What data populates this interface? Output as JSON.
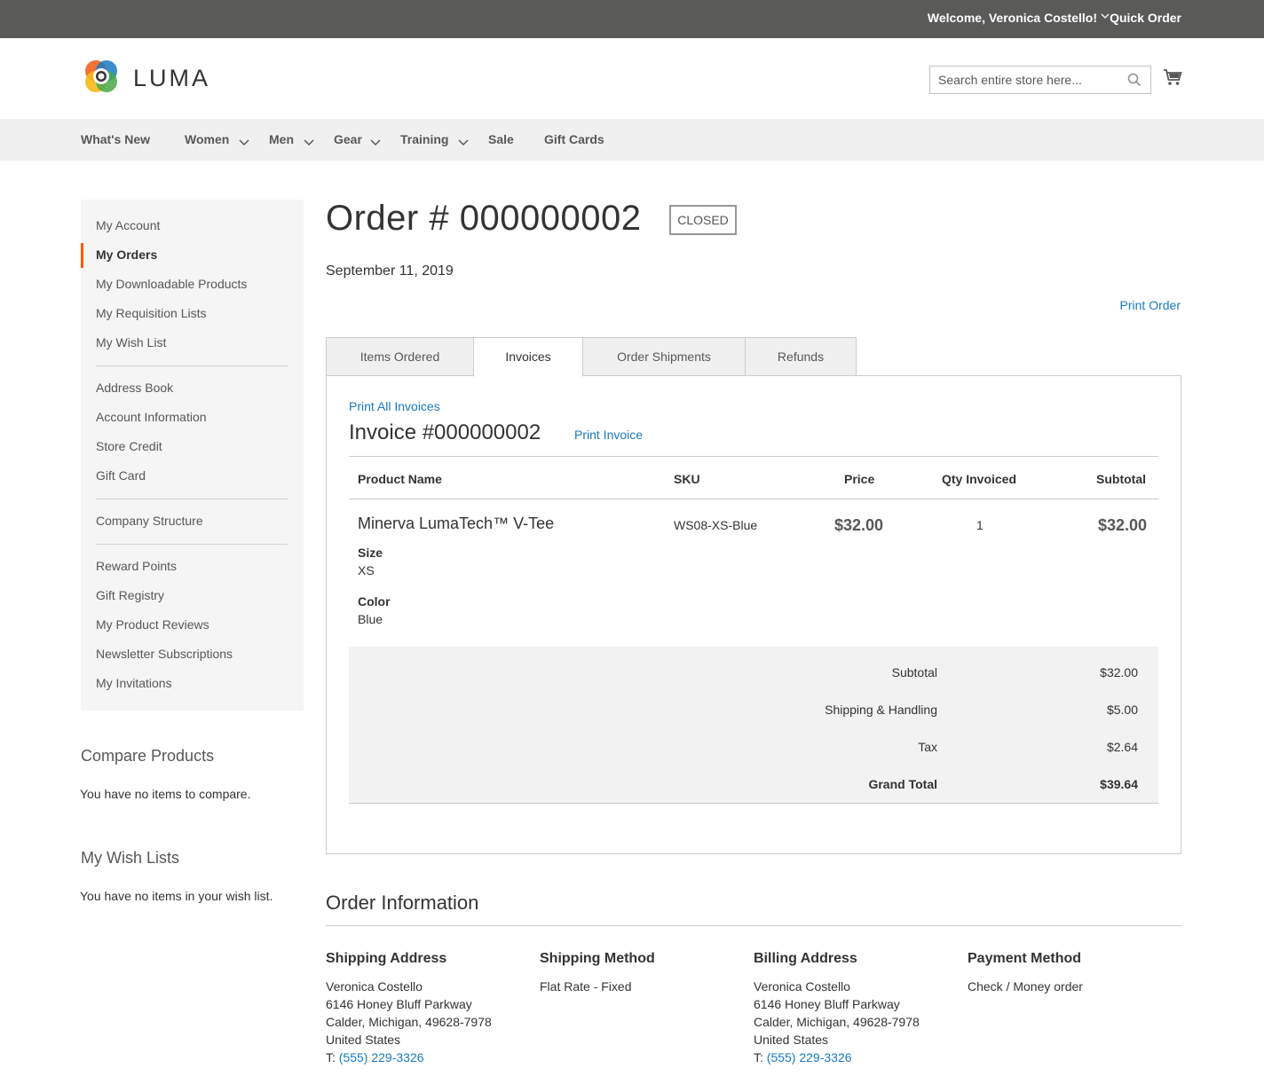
{
  "topbar": {
    "welcome": "Welcome, Veronica Costello!",
    "quick_order": "Quick Order"
  },
  "header": {
    "logo_text": "LUMA",
    "search_placeholder": "Search entire store here..."
  },
  "nav": [
    "What's New",
    "Women",
    "Men",
    "Gear",
    "Training",
    "Sale",
    "Gift Cards"
  ],
  "sidebar": {
    "items": [
      "My Account",
      "My Orders",
      "My Downloadable Products",
      "My Requisition Lists",
      "My Wish List",
      "Address Book",
      "Account Information",
      "Store Credit",
      "Gift Card",
      "Company Structure",
      "Reward Points",
      "Gift Registry",
      "My Product Reviews",
      "Newsletter Subscriptions",
      "My Invitations"
    ],
    "active": "My Orders"
  },
  "compare": {
    "title": "Compare Products",
    "text": "You have no items to compare."
  },
  "wishlists": {
    "title": "My Wish Lists",
    "text": "You have no items in your wish list."
  },
  "order": {
    "title": "Order # 000000002",
    "status": "CLOSED",
    "date": "September 11, 2019",
    "print_order": "Print Order",
    "tabs": [
      "Items Ordered",
      "Invoices",
      "Order Shipments",
      "Refunds"
    ],
    "active_tab": "Invoices"
  },
  "invoice": {
    "print_all": "Print All Invoices",
    "title": "Invoice #000000002",
    "print_invoice": "Print Invoice",
    "headers": {
      "name": "Product Name",
      "sku": "SKU",
      "price": "Price",
      "qty": "Qty Invoiced",
      "subtotal": "Subtotal"
    },
    "item": {
      "name": "Minerva LumaTech™ V-Tee",
      "sku": "WS08-XS-Blue",
      "price": "$32.00",
      "qty": "1",
      "subtotal": "$32.00",
      "options": [
        {
          "label": "Size",
          "value": "XS"
        },
        {
          "label": "Color",
          "value": "Blue"
        }
      ]
    },
    "totals": [
      {
        "label": "Subtotal",
        "value": "$32.00"
      },
      {
        "label": "Shipping & Handling",
        "value": "$5.00"
      },
      {
        "label": "Tax",
        "value": "$2.64"
      },
      {
        "label": "Grand Total",
        "value": "$39.64"
      }
    ]
  },
  "order_info": {
    "title": "Order Information",
    "shipping_address": {
      "title": "Shipping Address",
      "name": "Veronica Costello",
      "street": "6146 Honey Bluff Parkway",
      "city": "Calder, Michigan, 49628-7978",
      "country": "United States",
      "phone_prefix": "T:",
      "phone": "(555) 229-3326"
    },
    "shipping_method": {
      "title": "Shipping Method",
      "value": "Flat Rate - Fixed"
    },
    "billing_address": {
      "title": "Billing Address",
      "name": "Veronica Costello",
      "street": "6146 Honey Bluff Parkway",
      "city": "Calder, Michigan, 49628-7978",
      "country": "United States",
      "phone_prefix": "T:",
      "phone": "(555) 229-3326"
    },
    "payment_method": {
      "title": "Payment Method",
      "value": "Check / Money order"
    }
  }
}
